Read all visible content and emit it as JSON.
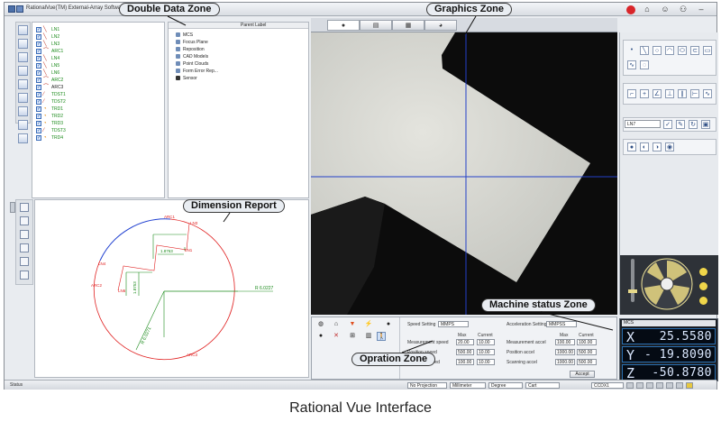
{
  "app": {
    "title": "RationalVue(TM) External-Array Software"
  },
  "features": [
    {
      "label": "LN1",
      "icon": "line-icon"
    },
    {
      "label": "LN2",
      "icon": "line-icon"
    },
    {
      "label": "LN3",
      "icon": "line-icon"
    },
    {
      "label": "ARC1",
      "icon": "arc-icon"
    },
    {
      "label": "LN4",
      "icon": "line-icon"
    },
    {
      "label": "LN5",
      "icon": "line-icon"
    },
    {
      "label": "LN6",
      "icon": "line-icon"
    },
    {
      "label": "ARC2",
      "icon": "arc-icon"
    },
    {
      "label": "ARC3",
      "icon": "arc-icon"
    },
    {
      "label": "TDST1",
      "icon": "distance-icon"
    },
    {
      "label": "TDST2",
      "icon": "distance-icon"
    },
    {
      "label": "TRD1",
      "icon": "radius-icon"
    },
    {
      "label": "TRD2",
      "icon": "radius-icon"
    },
    {
      "label": "TRD3",
      "icon": "radius-icon"
    },
    {
      "label": "TDST3",
      "icon": "distance-icon"
    },
    {
      "label": "TRD4",
      "icon": "radius-icon"
    }
  ],
  "tree": {
    "header": "Parent Label",
    "items": [
      "MCS",
      "Focus Plane",
      "Reposition",
      "CAD Models",
      "Point Clouds",
      "Form Error Rep...",
      "Sensor"
    ]
  },
  "dimension_report": {
    "labels": [
      "ARC1",
      "LN3",
      "LN1",
      "LN4",
      "ARC2",
      "LN6",
      "ARC3",
      "R 6.0227",
      "R 6.0271"
    ],
    "dims": [
      "1.8763",
      "1.8753"
    ]
  },
  "right_panel": {
    "feature_select": "LN7"
  },
  "operation": {
    "speed_setting_label": "Speed Setting",
    "speed_setting_value": "MMPS",
    "accel_setting_label": "Acceleration Setting",
    "accel_setting_value": "MMPSS",
    "col_max": "Max",
    "col_current": "Current",
    "rows_speed": [
      {
        "label": "Measurement speed",
        "max": "20.00",
        "current": "10.00"
      },
      {
        "label": "Position speed",
        "max": "500.00",
        "current": "10.00"
      },
      {
        "label": "Scanning speed",
        "max": "100.00",
        "current": "10.00"
      }
    ],
    "rows_accel": [
      {
        "label": "Measurement accel",
        "max": "100.00",
        "current": "100.00"
      },
      {
        "label": "Position accel",
        "max": "1000.00",
        "current": "500.00"
      },
      {
        "label": "Scanning accel",
        "max": "1000.00",
        "current": "500.00"
      }
    ],
    "accept": "Accept"
  },
  "machine": {
    "cs": "MCS",
    "axes": [
      {
        "axis": "X",
        "value": "25.5580"
      },
      {
        "axis": "Y",
        "value": "- 19.8090"
      },
      {
        "axis": "Z",
        "value": "-50.8780"
      }
    ]
  },
  "statusbar": {
    "status": "Status",
    "projection": "No Projection",
    "unit": "Millimeter",
    "angle": "Degree",
    "coord": "Cart",
    "device": "CCDX1"
  },
  "callouts": {
    "double_data": "Double Data Zone",
    "graphics": "Graphics Zone",
    "dimension": "Dimension Report",
    "machine": "Machine status Zone",
    "operation": "Opration Zone"
  },
  "caption": "Rational Vue Interface",
  "colors": {
    "feature_text": "#1a8a1a",
    "crosshair": "#2340c8",
    "arc_red": "#e02020",
    "arc_blue": "#2040d0"
  }
}
